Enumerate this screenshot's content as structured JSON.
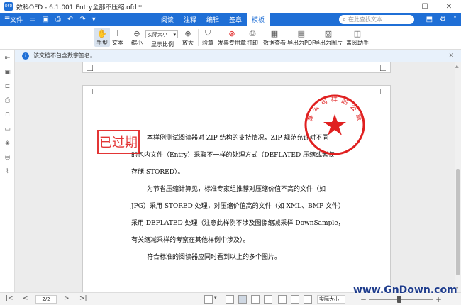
{
  "window": {
    "app_icon": "OFD",
    "title": "数科OFD - 6.1.001 Entry全部不压缩.ofd *",
    "min": "─",
    "max": "☐",
    "close": "✕"
  },
  "menubar": {
    "file_label": "文件",
    "tabs": [
      {
        "label": "阅读",
        "active": false
      },
      {
        "label": "注释",
        "active": false
      },
      {
        "label": "编辑",
        "active": false
      },
      {
        "label": "签章",
        "active": false
      },
      {
        "label": "模板",
        "active": true
      }
    ],
    "search_placeholder": "在此查找文本",
    "accent": "#1f6fd6"
  },
  "ribbon": {
    "hand": "手型",
    "text": "文本",
    "zoom_out": "缩小",
    "zoom_value": "实际大小",
    "display_ratio": "显示比例",
    "zoom_in": "放大",
    "verify": "验章",
    "send_stamp": "发票专用章",
    "print": "打印",
    "data_view": "数据查看",
    "export_pdf": "导出为PDF",
    "export_image": "导出为图片",
    "seal_assistant": "盖阅助手"
  },
  "notice": {
    "text": "该文档不包含数字签名。",
    "close": "✕"
  },
  "document": {
    "paragraphs": [
      "本样例测试阅读器对 ZIP 结构的支持情况，ZIP 规范允许对不同",
      "的包内文件（Entry）采取不一样的处理方式（DEFLATED 压缩或者仅",
      "存储 STORED）。",
      "为节省压缩计算见，标准专家组推荐对压缩价值不高的文件（如",
      "JPG）采用 STORED 处理，对压缩价值高的文件（如 XML、BMP 文件）",
      "采用 DEFLATED 处理（注意此样例不涉及图像缩减采样 DownSample，",
      "有关缩减采样的考察在其他样例中涉及）。",
      "符合标准的阅读器应同时看到以上的多个图片。"
    ],
    "stamp_text": "已过期",
    "seal_text": "某 公 司 样 品 公 章"
  },
  "statusbar": {
    "first": "|<",
    "prev": "<",
    "page": "2/2",
    "next": ">",
    "last": ">|",
    "zoom": "实际大小",
    "minus": "－",
    "plus": "＋"
  },
  "watermark": "www.GnDown.com"
}
